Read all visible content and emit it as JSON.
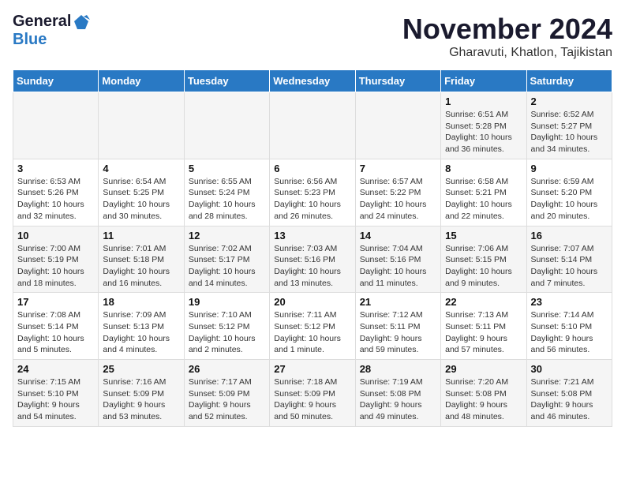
{
  "logo": {
    "line1": "General",
    "line2": "Blue"
  },
  "title": "November 2024",
  "location": "Gharavuti, Khatlon, Tajikistan",
  "days_of_week": [
    "Sunday",
    "Monday",
    "Tuesday",
    "Wednesday",
    "Thursday",
    "Friday",
    "Saturday"
  ],
  "weeks": [
    [
      {
        "day": "",
        "sunrise": "",
        "sunset": "",
        "daylight": ""
      },
      {
        "day": "",
        "sunrise": "",
        "sunset": "",
        "daylight": ""
      },
      {
        "day": "",
        "sunrise": "",
        "sunset": "",
        "daylight": ""
      },
      {
        "day": "",
        "sunrise": "",
        "sunset": "",
        "daylight": ""
      },
      {
        "day": "",
        "sunrise": "",
        "sunset": "",
        "daylight": ""
      },
      {
        "day": "1",
        "sunrise": "Sunrise: 6:51 AM",
        "sunset": "Sunset: 5:28 PM",
        "daylight": "Daylight: 10 hours and 36 minutes."
      },
      {
        "day": "2",
        "sunrise": "Sunrise: 6:52 AM",
        "sunset": "Sunset: 5:27 PM",
        "daylight": "Daylight: 10 hours and 34 minutes."
      }
    ],
    [
      {
        "day": "3",
        "sunrise": "Sunrise: 6:53 AM",
        "sunset": "Sunset: 5:26 PM",
        "daylight": "Daylight: 10 hours and 32 minutes."
      },
      {
        "day": "4",
        "sunrise": "Sunrise: 6:54 AM",
        "sunset": "Sunset: 5:25 PM",
        "daylight": "Daylight: 10 hours and 30 minutes."
      },
      {
        "day": "5",
        "sunrise": "Sunrise: 6:55 AM",
        "sunset": "Sunset: 5:24 PM",
        "daylight": "Daylight: 10 hours and 28 minutes."
      },
      {
        "day": "6",
        "sunrise": "Sunrise: 6:56 AM",
        "sunset": "Sunset: 5:23 PM",
        "daylight": "Daylight: 10 hours and 26 minutes."
      },
      {
        "day": "7",
        "sunrise": "Sunrise: 6:57 AM",
        "sunset": "Sunset: 5:22 PM",
        "daylight": "Daylight: 10 hours and 24 minutes."
      },
      {
        "day": "8",
        "sunrise": "Sunrise: 6:58 AM",
        "sunset": "Sunset: 5:21 PM",
        "daylight": "Daylight: 10 hours and 22 minutes."
      },
      {
        "day": "9",
        "sunrise": "Sunrise: 6:59 AM",
        "sunset": "Sunset: 5:20 PM",
        "daylight": "Daylight: 10 hours and 20 minutes."
      }
    ],
    [
      {
        "day": "10",
        "sunrise": "Sunrise: 7:00 AM",
        "sunset": "Sunset: 5:19 PM",
        "daylight": "Daylight: 10 hours and 18 minutes."
      },
      {
        "day": "11",
        "sunrise": "Sunrise: 7:01 AM",
        "sunset": "Sunset: 5:18 PM",
        "daylight": "Daylight: 10 hours and 16 minutes."
      },
      {
        "day": "12",
        "sunrise": "Sunrise: 7:02 AM",
        "sunset": "Sunset: 5:17 PM",
        "daylight": "Daylight: 10 hours and 14 minutes."
      },
      {
        "day": "13",
        "sunrise": "Sunrise: 7:03 AM",
        "sunset": "Sunset: 5:16 PM",
        "daylight": "Daylight: 10 hours and 13 minutes."
      },
      {
        "day": "14",
        "sunrise": "Sunrise: 7:04 AM",
        "sunset": "Sunset: 5:16 PM",
        "daylight": "Daylight: 10 hours and 11 minutes."
      },
      {
        "day": "15",
        "sunrise": "Sunrise: 7:06 AM",
        "sunset": "Sunset: 5:15 PM",
        "daylight": "Daylight: 10 hours and 9 minutes."
      },
      {
        "day": "16",
        "sunrise": "Sunrise: 7:07 AM",
        "sunset": "Sunset: 5:14 PM",
        "daylight": "Daylight: 10 hours and 7 minutes."
      }
    ],
    [
      {
        "day": "17",
        "sunrise": "Sunrise: 7:08 AM",
        "sunset": "Sunset: 5:14 PM",
        "daylight": "Daylight: 10 hours and 5 minutes."
      },
      {
        "day": "18",
        "sunrise": "Sunrise: 7:09 AM",
        "sunset": "Sunset: 5:13 PM",
        "daylight": "Daylight: 10 hours and 4 minutes."
      },
      {
        "day": "19",
        "sunrise": "Sunrise: 7:10 AM",
        "sunset": "Sunset: 5:12 PM",
        "daylight": "Daylight: 10 hours and 2 minutes."
      },
      {
        "day": "20",
        "sunrise": "Sunrise: 7:11 AM",
        "sunset": "Sunset: 5:12 PM",
        "daylight": "Daylight: 10 hours and 1 minute."
      },
      {
        "day": "21",
        "sunrise": "Sunrise: 7:12 AM",
        "sunset": "Sunset: 5:11 PM",
        "daylight": "Daylight: 9 hours and 59 minutes."
      },
      {
        "day": "22",
        "sunrise": "Sunrise: 7:13 AM",
        "sunset": "Sunset: 5:11 PM",
        "daylight": "Daylight: 9 hours and 57 minutes."
      },
      {
        "day": "23",
        "sunrise": "Sunrise: 7:14 AM",
        "sunset": "Sunset: 5:10 PM",
        "daylight": "Daylight: 9 hours and 56 minutes."
      }
    ],
    [
      {
        "day": "24",
        "sunrise": "Sunrise: 7:15 AM",
        "sunset": "Sunset: 5:10 PM",
        "daylight": "Daylight: 9 hours and 54 minutes."
      },
      {
        "day": "25",
        "sunrise": "Sunrise: 7:16 AM",
        "sunset": "Sunset: 5:09 PM",
        "daylight": "Daylight: 9 hours and 53 minutes."
      },
      {
        "day": "26",
        "sunrise": "Sunrise: 7:17 AM",
        "sunset": "Sunset: 5:09 PM",
        "daylight": "Daylight: 9 hours and 52 minutes."
      },
      {
        "day": "27",
        "sunrise": "Sunrise: 7:18 AM",
        "sunset": "Sunset: 5:09 PM",
        "daylight": "Daylight: 9 hours and 50 minutes."
      },
      {
        "day": "28",
        "sunrise": "Sunrise: 7:19 AM",
        "sunset": "Sunset: 5:08 PM",
        "daylight": "Daylight: 9 hours and 49 minutes."
      },
      {
        "day": "29",
        "sunrise": "Sunrise: 7:20 AM",
        "sunset": "Sunset: 5:08 PM",
        "daylight": "Daylight: 9 hours and 48 minutes."
      },
      {
        "day": "30",
        "sunrise": "Sunrise: 7:21 AM",
        "sunset": "Sunset: 5:08 PM",
        "daylight": "Daylight: 9 hours and 46 minutes."
      }
    ]
  ]
}
